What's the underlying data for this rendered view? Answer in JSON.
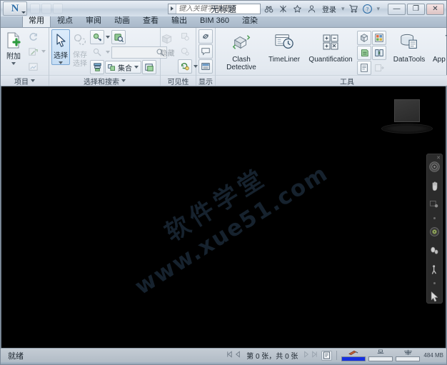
{
  "window": {
    "app_logo_letter": "N",
    "document_title": "无标题",
    "minimize_label": "—",
    "maximize_label": "❐",
    "close_label": "✕"
  },
  "infocenter": {
    "search_placeholder": "键入关键字或短语",
    "search_value": "",
    "signin_label": "登录",
    "icons": [
      "binoculars-icon",
      "subscription-icon",
      "favorites-star-icon",
      "user-account-icon"
    ],
    "cart_icon": "cart-icon",
    "help_icon": "help-icon",
    "separator": "▾"
  },
  "tabs": [
    {
      "label": "常用",
      "active": true
    },
    {
      "label": "视点",
      "active": false
    },
    {
      "label": "审阅",
      "active": false
    },
    {
      "label": "动画",
      "active": false
    },
    {
      "label": "查看",
      "active": false
    },
    {
      "label": "输出",
      "active": false
    },
    {
      "label": "BIM 360",
      "active": false
    },
    {
      "label": "渲染",
      "active": false
    }
  ],
  "ribbon": {
    "panels": [
      {
        "id": "project",
        "label": "项目",
        "big_button": {
          "label": "附加",
          "icon": "attach-file-icon",
          "has_caret": true
        },
        "small_buttons": [
          {
            "name": "refresh-icon",
            "enabled": false
          },
          {
            "name": "reset-all-icon",
            "enabled": false,
            "has_caret": true
          },
          {
            "name": "file-options-icon",
            "enabled": false
          }
        ]
      },
      {
        "id": "select-search",
        "label": "选择和搜索",
        "select_button": {
          "label": "选择",
          "icon": "select-arrow-icon",
          "has_caret": true
        },
        "save_selection": {
          "line1": "保存",
          "line2": "选择",
          "icon": "save-selection-icon",
          "enabled": false
        },
        "find_placeholder": "",
        "find_value": "",
        "sets_label": "集合",
        "small_buttons": [
          {
            "name": "select-same-icon",
            "enabled": true,
            "has_caret": true
          },
          {
            "name": "find-items-icon",
            "enabled": true
          },
          {
            "name": "quick-find-icon",
            "enabled": false,
            "has_caret": true
          },
          {
            "name": "selection-tree-icon",
            "enabled": true
          },
          {
            "name": "sets-dropdown-icon",
            "enabled": true
          },
          {
            "name": "selection-inspector-icon",
            "enabled": true
          }
        ]
      },
      {
        "id": "visibility",
        "label": "可见性",
        "hide_label": "隐藏",
        "small_buttons": [
          {
            "name": "hide-unselected-icon",
            "enabled": false
          },
          {
            "name": "hide-icon",
            "enabled": false
          },
          {
            "name": "require-icon",
            "enabled": false
          },
          {
            "name": "unhide-all-icon",
            "enabled": true,
            "has_caret": true
          }
        ]
      },
      {
        "id": "display",
        "label": "显示",
        "small_buttons": [
          {
            "name": "links-icon",
            "enabled": true
          },
          {
            "name": "quick-properties-icon",
            "enabled": true
          },
          {
            "name": "properties-icon",
            "enabled": true
          }
        ]
      },
      {
        "id": "tools",
        "label": "工具",
        "tool_buttons": [
          {
            "label": "Clash\nDetective",
            "icon": "clash-detective-icon"
          },
          {
            "label": "TimeLiner",
            "icon": "timeliner-icon"
          },
          {
            "label": "Quantification",
            "icon": "quantification-icon"
          },
          {
            "label": "DataTools",
            "icon": "datatools-icon"
          },
          {
            "label": "App Manager",
            "icon": "app-manager-icon"
          }
        ],
        "grid_buttons": [
          {
            "name": "autodesk-rendering-icon",
            "enabled": true
          },
          {
            "name": "animator-icon",
            "enabled": true
          },
          {
            "name": "scripter-icon",
            "enabled": true
          },
          {
            "name": "compare-icon",
            "enabled": true
          },
          {
            "name": "batch-utility-icon",
            "enabled": true
          },
          {
            "name": "switchback-icon",
            "enabled": false
          }
        ]
      }
    ]
  },
  "viewport": {
    "watermark_cn": "软件学堂",
    "watermark_url": "www.xue51.com",
    "viewcube_name": "view-cube",
    "navbar_items": [
      "steering-wheel-icon",
      "pan-icon",
      "zoom-icon",
      "orbit-icon",
      "look-around-icon",
      "walk-icon",
      "select-cursor-icon"
    ]
  },
  "statusbar": {
    "status_text": "就绪",
    "page_count": "第 0 张，共 0 张",
    "prev_all_icon": "first-sheet-icon",
    "prev_icon": "prev-sheet-icon",
    "next_icon": "next-sheet-icon",
    "next_all_icon": "last-sheet-icon",
    "sheet_browser_icon": "sheet-browser-icon",
    "gauges": [
      {
        "name": "render-progress",
        "icon": "pencil-icon",
        "percent": 100,
        "color": "#1530e0"
      },
      {
        "name": "disk-usage",
        "icon": "disk-icon",
        "percent": 0,
        "color": "#1530e0"
      },
      {
        "name": "web-progress",
        "icon": "web-icon",
        "percent": 0,
        "color": "#1530e0"
      }
    ],
    "memory_label": "484 MB"
  }
}
